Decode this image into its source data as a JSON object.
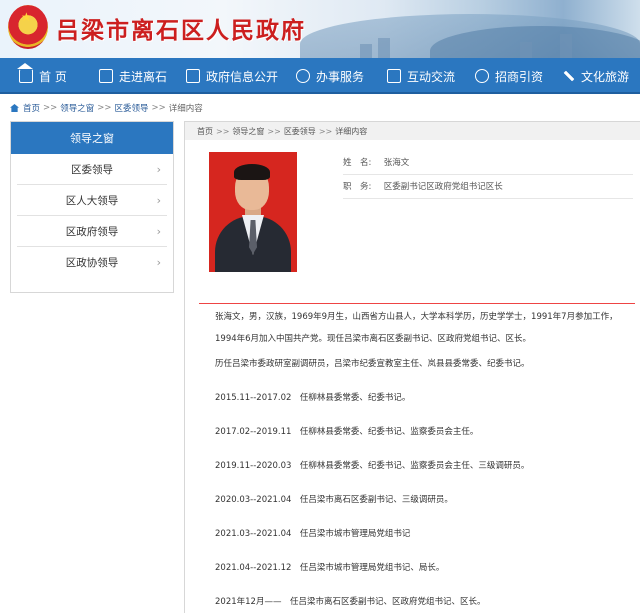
{
  "header": {
    "site_title": "吕梁市离石区人民政府"
  },
  "nav": [
    {
      "label": "首 页",
      "icon": "home-icon"
    },
    {
      "label": "走进离石",
      "icon": "book-icon"
    },
    {
      "label": "政府信息公开",
      "icon": "document-icon"
    },
    {
      "label": "办事服务",
      "icon": "user-icon"
    },
    {
      "label": "互动交流",
      "icon": "chat-icon"
    },
    {
      "label": "招商引资",
      "icon": "globe-icon"
    },
    {
      "label": "文化旅游",
      "icon": "plane-icon"
    }
  ],
  "breadcrumb": {
    "home": "首页",
    "level1": "领导之窗",
    "level2": "区委领导",
    "current": "详细内容",
    "sep": ">>"
  },
  "sidebar": {
    "title": "领导之窗",
    "items": [
      {
        "label": "区委领导"
      },
      {
        "label": "区人大领导"
      },
      {
        "label": "区政府领导"
      },
      {
        "label": "区政协领导"
      }
    ]
  },
  "content": {
    "breadcrumb": {
      "home": "首页",
      "level1": "领导之窗",
      "level2": "区委领导",
      "current": "详细内容",
      "sep": ">>"
    },
    "name_label": "姓　名:",
    "name_value": "张海文",
    "position_label": "职　务:",
    "position_value": "区委副书记区政府党组书记区长",
    "bio_intro": "张海文，男，汉族，1969年9月生，山西省方山县人，大学本科学历，历史学学士，1991年7月参加工作，1994年6月加入中国共产党。现任吕梁市离石区委副书记、区政府党组书记、区长。",
    "history_intro": "历任吕梁市委政研室副调研员，吕梁市纪委宣教室主任、岚县县委常委、纪委书记。",
    "timeline": [
      "2015.11--2017.02　任柳林县委常委、纪委书记。",
      "2017.02--2019.11　任柳林县委常委、纪委书记、监察委员会主任。",
      "2019.11--2020.03　任柳林县委常委、纪委书记、监察委员会主任、三级调研员。",
      "2020.03--2021.04　任吕梁市离石区委副书记、三级调研员。",
      "2021.03--2021.04　任吕梁市城市管理局党组书记",
      "2021.04--2021.12　任吕梁市城市管理局党组书记、局长。",
      "2021年12月——　任吕梁市离石区委副书记、区政府党组书记、区长。"
    ]
  }
}
